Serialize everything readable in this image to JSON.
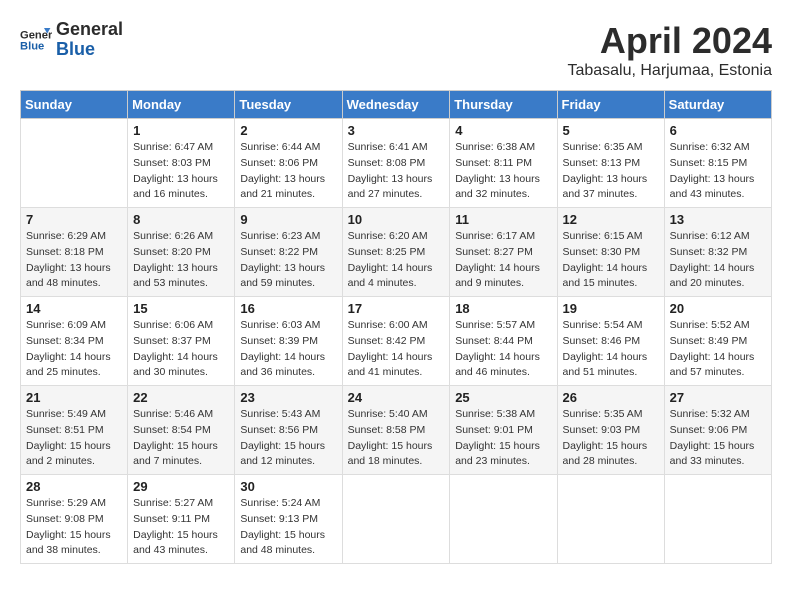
{
  "logo": {
    "line1": "General",
    "line2": "Blue"
  },
  "title": "April 2024",
  "location": "Tabasalu, Harjumaa, Estonia",
  "weekdays": [
    "Sunday",
    "Monday",
    "Tuesday",
    "Wednesday",
    "Thursday",
    "Friday",
    "Saturday"
  ],
  "weeks": [
    [
      {
        "day": "",
        "info": ""
      },
      {
        "day": "1",
        "info": "Sunrise: 6:47 AM\nSunset: 8:03 PM\nDaylight: 13 hours\nand 16 minutes."
      },
      {
        "day": "2",
        "info": "Sunrise: 6:44 AM\nSunset: 8:06 PM\nDaylight: 13 hours\nand 21 minutes."
      },
      {
        "day": "3",
        "info": "Sunrise: 6:41 AM\nSunset: 8:08 PM\nDaylight: 13 hours\nand 27 minutes."
      },
      {
        "day": "4",
        "info": "Sunrise: 6:38 AM\nSunset: 8:11 PM\nDaylight: 13 hours\nand 32 minutes."
      },
      {
        "day": "5",
        "info": "Sunrise: 6:35 AM\nSunset: 8:13 PM\nDaylight: 13 hours\nand 37 minutes."
      },
      {
        "day": "6",
        "info": "Sunrise: 6:32 AM\nSunset: 8:15 PM\nDaylight: 13 hours\nand 43 minutes."
      }
    ],
    [
      {
        "day": "7",
        "info": "Sunrise: 6:29 AM\nSunset: 8:18 PM\nDaylight: 13 hours\nand 48 minutes."
      },
      {
        "day": "8",
        "info": "Sunrise: 6:26 AM\nSunset: 8:20 PM\nDaylight: 13 hours\nand 53 minutes."
      },
      {
        "day": "9",
        "info": "Sunrise: 6:23 AM\nSunset: 8:22 PM\nDaylight: 13 hours\nand 59 minutes."
      },
      {
        "day": "10",
        "info": "Sunrise: 6:20 AM\nSunset: 8:25 PM\nDaylight: 14 hours\nand 4 minutes."
      },
      {
        "day": "11",
        "info": "Sunrise: 6:17 AM\nSunset: 8:27 PM\nDaylight: 14 hours\nand 9 minutes."
      },
      {
        "day": "12",
        "info": "Sunrise: 6:15 AM\nSunset: 8:30 PM\nDaylight: 14 hours\nand 15 minutes."
      },
      {
        "day": "13",
        "info": "Sunrise: 6:12 AM\nSunset: 8:32 PM\nDaylight: 14 hours\nand 20 minutes."
      }
    ],
    [
      {
        "day": "14",
        "info": "Sunrise: 6:09 AM\nSunset: 8:34 PM\nDaylight: 14 hours\nand 25 minutes."
      },
      {
        "day": "15",
        "info": "Sunrise: 6:06 AM\nSunset: 8:37 PM\nDaylight: 14 hours\nand 30 minutes."
      },
      {
        "day": "16",
        "info": "Sunrise: 6:03 AM\nSunset: 8:39 PM\nDaylight: 14 hours\nand 36 minutes."
      },
      {
        "day": "17",
        "info": "Sunrise: 6:00 AM\nSunset: 8:42 PM\nDaylight: 14 hours\nand 41 minutes."
      },
      {
        "day": "18",
        "info": "Sunrise: 5:57 AM\nSunset: 8:44 PM\nDaylight: 14 hours\nand 46 minutes."
      },
      {
        "day": "19",
        "info": "Sunrise: 5:54 AM\nSunset: 8:46 PM\nDaylight: 14 hours\nand 51 minutes."
      },
      {
        "day": "20",
        "info": "Sunrise: 5:52 AM\nSunset: 8:49 PM\nDaylight: 14 hours\nand 57 minutes."
      }
    ],
    [
      {
        "day": "21",
        "info": "Sunrise: 5:49 AM\nSunset: 8:51 PM\nDaylight: 15 hours\nand 2 minutes."
      },
      {
        "day": "22",
        "info": "Sunrise: 5:46 AM\nSunset: 8:54 PM\nDaylight: 15 hours\nand 7 minutes."
      },
      {
        "day": "23",
        "info": "Sunrise: 5:43 AM\nSunset: 8:56 PM\nDaylight: 15 hours\nand 12 minutes."
      },
      {
        "day": "24",
        "info": "Sunrise: 5:40 AM\nSunset: 8:58 PM\nDaylight: 15 hours\nand 18 minutes."
      },
      {
        "day": "25",
        "info": "Sunrise: 5:38 AM\nSunset: 9:01 PM\nDaylight: 15 hours\nand 23 minutes."
      },
      {
        "day": "26",
        "info": "Sunrise: 5:35 AM\nSunset: 9:03 PM\nDaylight: 15 hours\nand 28 minutes."
      },
      {
        "day": "27",
        "info": "Sunrise: 5:32 AM\nSunset: 9:06 PM\nDaylight: 15 hours\nand 33 minutes."
      }
    ],
    [
      {
        "day": "28",
        "info": "Sunrise: 5:29 AM\nSunset: 9:08 PM\nDaylight: 15 hours\nand 38 minutes."
      },
      {
        "day": "29",
        "info": "Sunrise: 5:27 AM\nSunset: 9:11 PM\nDaylight: 15 hours\nand 43 minutes."
      },
      {
        "day": "30",
        "info": "Sunrise: 5:24 AM\nSunset: 9:13 PM\nDaylight: 15 hours\nand 48 minutes."
      },
      {
        "day": "",
        "info": ""
      },
      {
        "day": "",
        "info": ""
      },
      {
        "day": "",
        "info": ""
      },
      {
        "day": "",
        "info": ""
      }
    ]
  ]
}
